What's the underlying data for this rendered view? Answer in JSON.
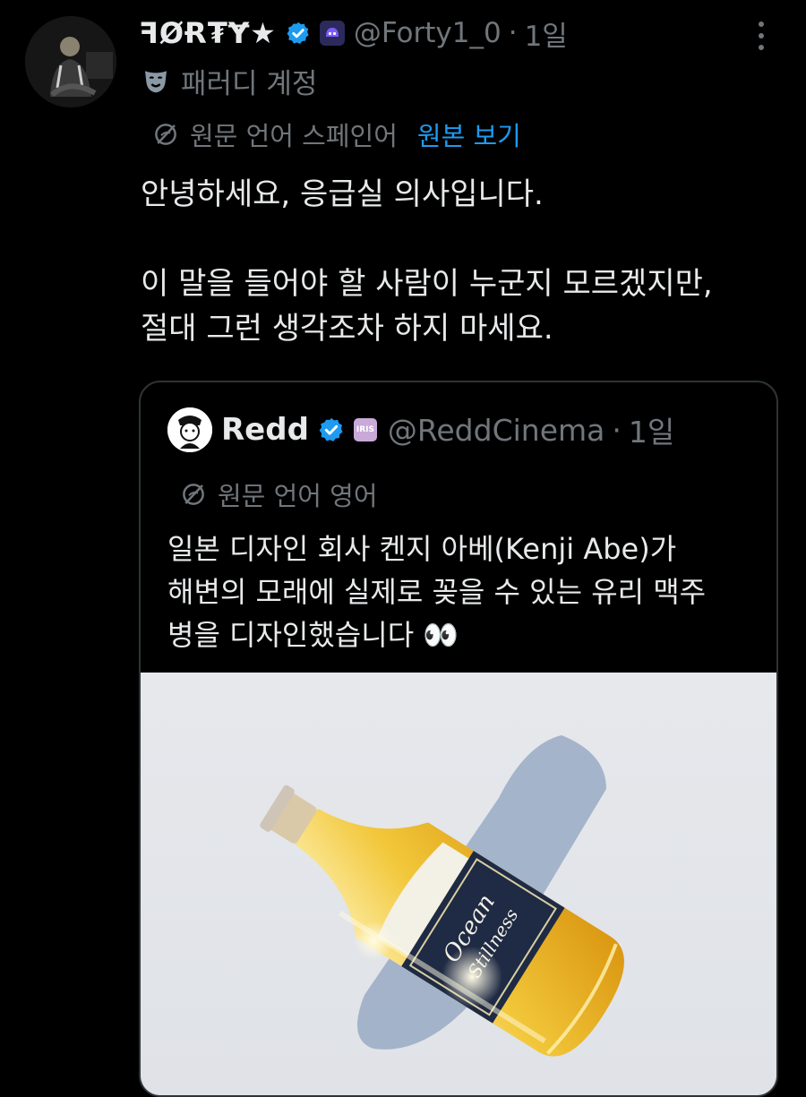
{
  "tweet": {
    "display_name": "ꟻØɌ₮Ɏ★",
    "handle": "@Forty1_0",
    "separator": "·",
    "time": "1일",
    "parody_label": "패러디 계정",
    "translation_note": "원문 언어 스페인어",
    "show_original": "원본 보기",
    "text_lines": [
      "안녕하세요, 응급실 의사입니다.",
      "이 말을 들어야 할 사람이 누군지 모르겠지만,",
      "절대 그런 생각조차 하지 마세요."
    ]
  },
  "quote": {
    "display_name": "Redd",
    "affiliate_badge": "IRIS",
    "handle": "@ReddCinema",
    "separator": "·",
    "time": "1일",
    "translation_note": "원문 언어 영어",
    "text_lines": [
      "일본 디자인 회사 켄지 아베(Kenji Abe)가",
      "해변의 모래에 실제로 꽂을 수 있는 유리 맥주",
      "병을 디자인했습니다 👀"
    ],
    "image_label_lines": [
      "Ocean",
      "Stillness"
    ]
  },
  "colors": {
    "background": "#000000",
    "text": "#e7e9ea",
    "secondary": "#71767b",
    "link": "#1d9bf0",
    "verified": "#1d9bf0",
    "border": "#2f3336"
  },
  "icons": {
    "verified": "verified-badge-icon",
    "affiliate": "affiliate-badge-icon",
    "more": "more-options-icon",
    "parody": "parody-mask-icon",
    "translate": "translate-globe-icon"
  }
}
